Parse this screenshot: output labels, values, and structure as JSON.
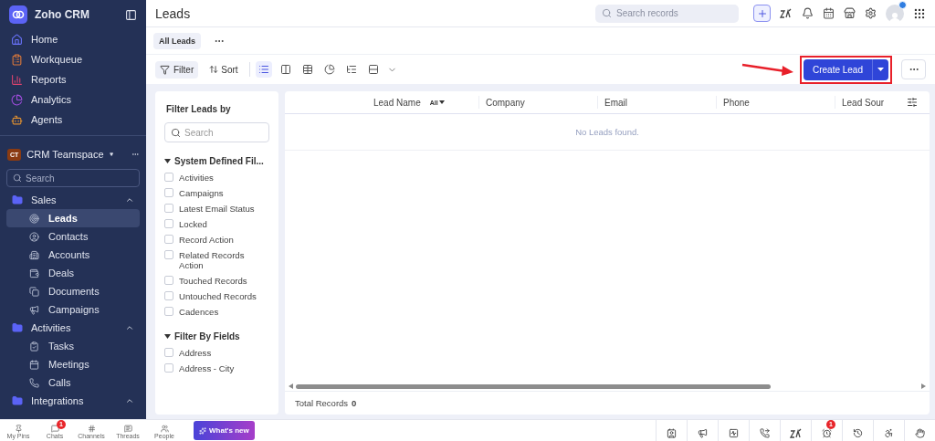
{
  "app": {
    "name": "Zoho CRM"
  },
  "sidebar": {
    "nav": [
      {
        "label": "Home",
        "kind": "home",
        "selected": false
      },
      {
        "label": "Workqueue",
        "kind": "queue",
        "selected": false
      },
      {
        "label": "Reports",
        "kind": "reports",
        "selected": false
      },
      {
        "label": "Analytics",
        "kind": "analytics",
        "selected": false
      },
      {
        "label": "Agents",
        "kind": "agents",
        "selected": false
      }
    ],
    "teamspace": {
      "badge": "CT",
      "name": "CRM Teamspace"
    },
    "search": {
      "placeholder": "Search"
    },
    "groups": [
      {
        "label": "Sales",
        "expanded": true,
        "children": [
          {
            "label": "Leads",
            "kind": "target",
            "selected": true
          },
          {
            "label": "Contacts",
            "kind": "contact",
            "selected": false
          },
          {
            "label": "Accounts",
            "kind": "building",
            "selected": false
          },
          {
            "label": "Deals",
            "kind": "wallet",
            "selected": false
          },
          {
            "label": "Documents",
            "kind": "docs",
            "selected": false
          },
          {
            "label": "Campaigns",
            "kind": "megaphone",
            "selected": false
          }
        ]
      },
      {
        "label": "Activities",
        "expanded": true,
        "children": [
          {
            "label": "Tasks",
            "kind": "task",
            "selected": false
          },
          {
            "label": "Meetings",
            "kind": "calendar",
            "selected": false
          },
          {
            "label": "Calls",
            "kind": "phone",
            "selected": false
          }
        ]
      },
      {
        "label": "Integrations",
        "expanded": true
      }
    ]
  },
  "header": {
    "title": "Leads",
    "search": {
      "placeholder": "Search records"
    }
  },
  "views": [
    {
      "label": "All Leads",
      "selected": true
    }
  ],
  "toolbar": {
    "filter": {
      "label": "Filter",
      "on": true
    },
    "sort": "Sort",
    "view_modes": [
      {
        "kind": "list",
        "selected": true
      },
      {
        "kind": "kanban",
        "selected": false
      },
      {
        "kind": "table",
        "selected": false
      },
      {
        "kind": "chart",
        "selected": false
      },
      {
        "kind": "tree",
        "selected": false
      },
      {
        "kind": "rows",
        "selected": false
      }
    ],
    "create_button": "Create Lead"
  },
  "filter_panel": {
    "title": "Filter Leads by",
    "search": {
      "placeholder": "Search"
    },
    "sections": [
      {
        "title": "System Defined Fil...",
        "expanded": true,
        "items": [
          {
            "label": "Activities",
            "checked": false
          },
          {
            "label": "Campaigns",
            "checked": false
          },
          {
            "label": "Latest Email Status",
            "checked": false
          },
          {
            "label": "Locked",
            "checked": false
          },
          {
            "label": "Record Action",
            "checked": false
          },
          {
            "label": "Related Records Action",
            "checked": false
          },
          {
            "label": "Touched Records",
            "checked": false
          },
          {
            "label": "Untouched Records",
            "checked": false
          },
          {
            "label": "Cadences",
            "checked": false
          }
        ]
      },
      {
        "title": "Filter By Fields",
        "expanded": true,
        "items": [
          {
            "label": "Address",
            "checked": false
          },
          {
            "label": "Address - City",
            "checked": false
          }
        ]
      }
    ]
  },
  "table": {
    "columns": [
      {
        "label": "Lead Name",
        "filter": "All"
      },
      {
        "label": "Company"
      },
      {
        "label": "Email"
      },
      {
        "label": "Phone"
      },
      {
        "label": "Lead Sour"
      }
    ],
    "empty_message": "No Leads found.",
    "total_label": "Total Records",
    "total": "0"
  },
  "bottom_bar": {
    "tabs": [
      {
        "label": "My Pins",
        "kind": "pin"
      },
      {
        "label": "Chats",
        "kind": "chat",
        "badge": "1"
      },
      {
        "label": "Channels",
        "kind": "channel"
      },
      {
        "label": "Threads",
        "kind": "thread"
      },
      {
        "label": "People",
        "kind": "people"
      }
    ],
    "whats_new": "What's new",
    "tools": [
      {
        "kind": "card"
      },
      {
        "kind": "megaphone"
      },
      {
        "kind": "activity"
      },
      {
        "kind": "forward"
      },
      {
        "kind": "zigzag"
      },
      {
        "kind": "alarm",
        "badge": "1"
      },
      {
        "kind": "history"
      },
      {
        "kind": "accessibility"
      },
      {
        "kind": "hand"
      }
    ]
  }
}
